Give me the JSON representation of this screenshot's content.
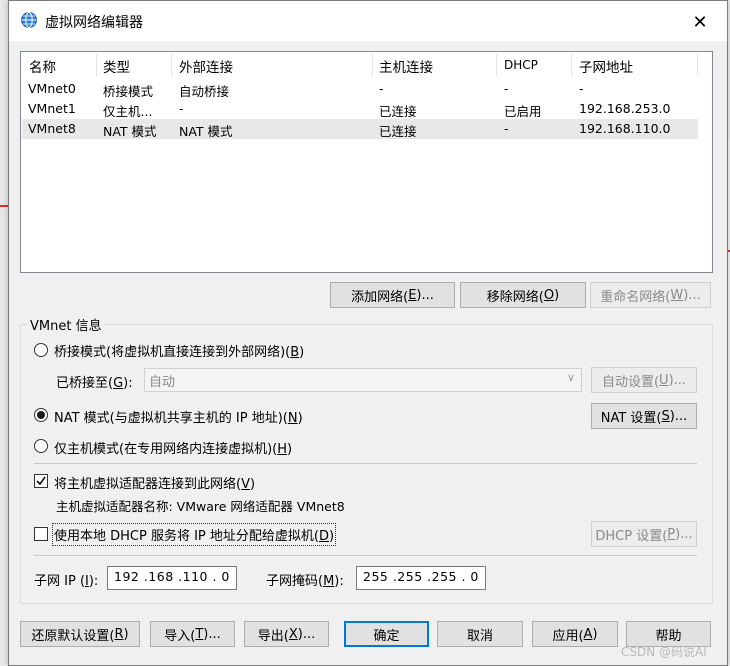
{
  "dialog": {
    "title": "虚拟网络编辑器",
    "close_label": "✕"
  },
  "list": {
    "columns": [
      "名称",
      "类型",
      "外部连接",
      "主机连接",
      "DHCP",
      "子网地址"
    ],
    "rows": [
      {
        "name": "VMnet0",
        "type": "桥接模式",
        "external": "自动桥接",
        "host": "-",
        "dhcp": "-",
        "subnet": "-"
      },
      {
        "name": "VMnet1",
        "type": "仅主机...",
        "external": "-",
        "host": "已连接",
        "dhcp": "已启用",
        "subnet": "192.168.253.0"
      },
      {
        "name": "VMnet8",
        "type": "NAT 模式",
        "external": "NAT 模式",
        "host": "已连接",
        "dhcp": "-",
        "subnet": "192.168.110.0"
      }
    ]
  },
  "list_buttons": {
    "add": {
      "text": "添加网络(",
      "key": "E",
      "tail": ")..."
    },
    "remove": {
      "text": "移除网络(",
      "key": "O",
      "tail": ")"
    },
    "rename": {
      "text": "重命名网络(",
      "key": "W",
      "tail": ")..."
    }
  },
  "vmnet_info": {
    "group_label": "VMnet 信息",
    "bridged": {
      "text": "桥接模式(将虚拟机直接连接到外部网络)(",
      "key": "B",
      "tail": ")"
    },
    "bridged_to": {
      "text": "已桥接至(",
      "key": "G",
      "tail": "):"
    },
    "bridged_to_value": "自动",
    "auto_settings": {
      "text": "自动设置(",
      "key": "U",
      "tail": ")..."
    },
    "nat": {
      "text": "NAT 模式(与虚拟机共享主机的 IP 地址)(",
      "key": "N",
      "tail": ")"
    },
    "nat_settings": {
      "text": "NAT 设置(",
      "key": "S",
      "tail": ")..."
    },
    "host_only": {
      "text": "仅主机模式(在专用网络内连接虚拟机)(",
      "key": "H",
      "tail": ")"
    },
    "connect_adapter": {
      "text": "将主机虚拟适配器连接到此网络(",
      "key": "V",
      "tail": ")"
    },
    "adapter_name": "主机虚拟适配器名称: VMware 网络适配器 VMnet8",
    "use_dhcp": {
      "text": "使用本地 DHCP 服务将 IP 地址分配给虚拟机(",
      "key": "D",
      "tail": ")"
    },
    "dhcp_settings": {
      "text": "DHCP 设置(",
      "key": "P",
      "tail": ")..."
    },
    "subnet_ip_label": {
      "text": "子网 IP (",
      "key": "I",
      "tail": "):"
    },
    "subnet_ip_value": "192 .168 .110 .  0",
    "subnet_mask_label": {
      "text": "子网掩码(",
      "key": "M",
      "tail": "):"
    },
    "subnet_mask_value": "255 .255 .255 .  0"
  },
  "footer": {
    "restore": {
      "text": "还原默认设置(",
      "key": "R",
      "tail": ")"
    },
    "import": {
      "text": "导入(",
      "key": "T",
      "tail": ")..."
    },
    "export": {
      "text": "导出(",
      "key": "X",
      "tail": ")..."
    },
    "ok": "确定",
    "cancel": "取消",
    "apply": {
      "text": "应用(",
      "key": "A",
      "tail": ")"
    },
    "help": "帮助"
  },
  "watermark": "CSDN @码说AI",
  "colors": {
    "accent": "#0078d7",
    "selected_row": "#e8e8e8",
    "dialog_bg": "#f0f0f0"
  }
}
